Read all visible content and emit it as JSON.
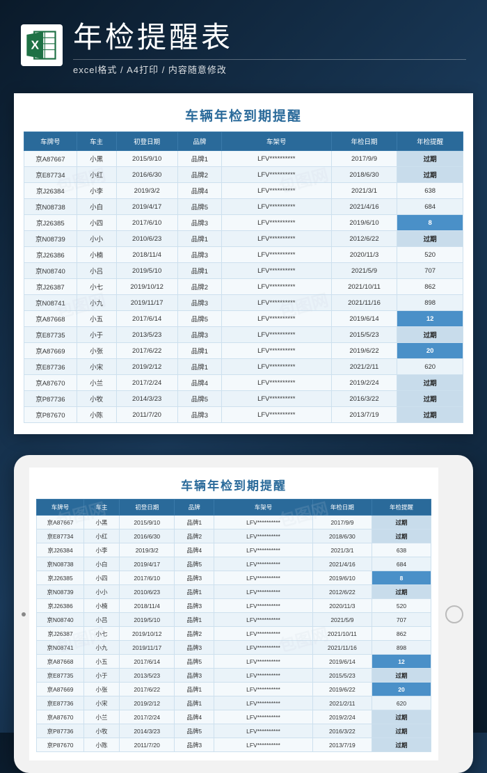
{
  "header": {
    "title": "年检提醒表",
    "subtitle": "excel格式 / A4打印 / 内容随意修改"
  },
  "sheet": {
    "title": "车辆年检到期提醒",
    "columns": [
      "车牌号",
      "车主",
      "初登日期",
      "品牌",
      "车架号",
      "年检日期",
      "年检提醒"
    ],
    "rows": [
      {
        "plate": "京A87667",
        "owner": "小黑",
        "reg": "2015/9/10",
        "brand": "品牌1",
        "vin": "LFV**********",
        "insp": "2017/9/9",
        "remind": "过期",
        "st": "overdue"
      },
      {
        "plate": "京E87734",
        "owner": "小红",
        "reg": "2016/6/30",
        "brand": "品牌2",
        "vin": "LFV**********",
        "insp": "2018/6/30",
        "remind": "过期",
        "st": "overdue"
      },
      {
        "plate": "京J26384",
        "owner": "小李",
        "reg": "2019/3/2",
        "brand": "品牌4",
        "vin": "LFV**********",
        "insp": "2021/3/1",
        "remind": "638",
        "st": ""
      },
      {
        "plate": "京N08738",
        "owner": "小白",
        "reg": "2019/4/17",
        "brand": "品牌5",
        "vin": "LFV**********",
        "insp": "2021/4/16",
        "remind": "684",
        "st": ""
      },
      {
        "plate": "京J26385",
        "owner": "小四",
        "reg": "2017/6/10",
        "brand": "品牌3",
        "vin": "LFV**********",
        "insp": "2019/6/10",
        "remind": "8",
        "st": "soon"
      },
      {
        "plate": "京N08739",
        "owner": "小小",
        "reg": "2010/6/23",
        "brand": "品牌1",
        "vin": "LFV**********",
        "insp": "2012/6/22",
        "remind": "过期",
        "st": "overdue"
      },
      {
        "plate": "京J26386",
        "owner": "小楠",
        "reg": "2018/11/4",
        "brand": "品牌3",
        "vin": "LFV**********",
        "insp": "2020/11/3",
        "remind": "520",
        "st": ""
      },
      {
        "plate": "京N08740",
        "owner": "小吕",
        "reg": "2019/5/10",
        "brand": "品牌1",
        "vin": "LFV**********",
        "insp": "2021/5/9",
        "remind": "707",
        "st": ""
      },
      {
        "plate": "京J26387",
        "owner": "小七",
        "reg": "2019/10/12",
        "brand": "品牌2",
        "vin": "LFV**********",
        "insp": "2021/10/11",
        "remind": "862",
        "st": ""
      },
      {
        "plate": "京N08741",
        "owner": "小九",
        "reg": "2019/11/17",
        "brand": "品牌3",
        "vin": "LFV**********",
        "insp": "2021/11/16",
        "remind": "898",
        "st": ""
      },
      {
        "plate": "京A87668",
        "owner": "小五",
        "reg": "2017/6/14",
        "brand": "品牌5",
        "vin": "LFV**********",
        "insp": "2019/6/14",
        "remind": "12",
        "st": "soon"
      },
      {
        "plate": "京E87735",
        "owner": "小于",
        "reg": "2013/5/23",
        "brand": "品牌3",
        "vin": "LFV**********",
        "insp": "2015/5/23",
        "remind": "过期",
        "st": "overdue"
      },
      {
        "plate": "京A87669",
        "owner": "小张",
        "reg": "2017/6/22",
        "brand": "品牌1",
        "vin": "LFV**********",
        "insp": "2019/6/22",
        "remind": "20",
        "st": "soon"
      },
      {
        "plate": "京E87736",
        "owner": "小宋",
        "reg": "2019/2/12",
        "brand": "品牌1",
        "vin": "LFV**********",
        "insp": "2021/2/11",
        "remind": "620",
        "st": ""
      },
      {
        "plate": "京A87670",
        "owner": "小兰",
        "reg": "2017/2/24",
        "brand": "品牌4",
        "vin": "LFV**********",
        "insp": "2019/2/24",
        "remind": "过期",
        "st": "overdue"
      },
      {
        "plate": "京P87736",
        "owner": "小牧",
        "reg": "2014/3/23",
        "brand": "品牌5",
        "vin": "LFV**********",
        "insp": "2016/3/22",
        "remind": "过期",
        "st": "overdue"
      },
      {
        "plate": "京P87670",
        "owner": "小陈",
        "reg": "2011/7/20",
        "brand": "品牌3",
        "vin": "LFV**********",
        "insp": "2013/7/19",
        "remind": "过期",
        "st": "overdue"
      }
    ]
  },
  "watermark": "包图网"
}
